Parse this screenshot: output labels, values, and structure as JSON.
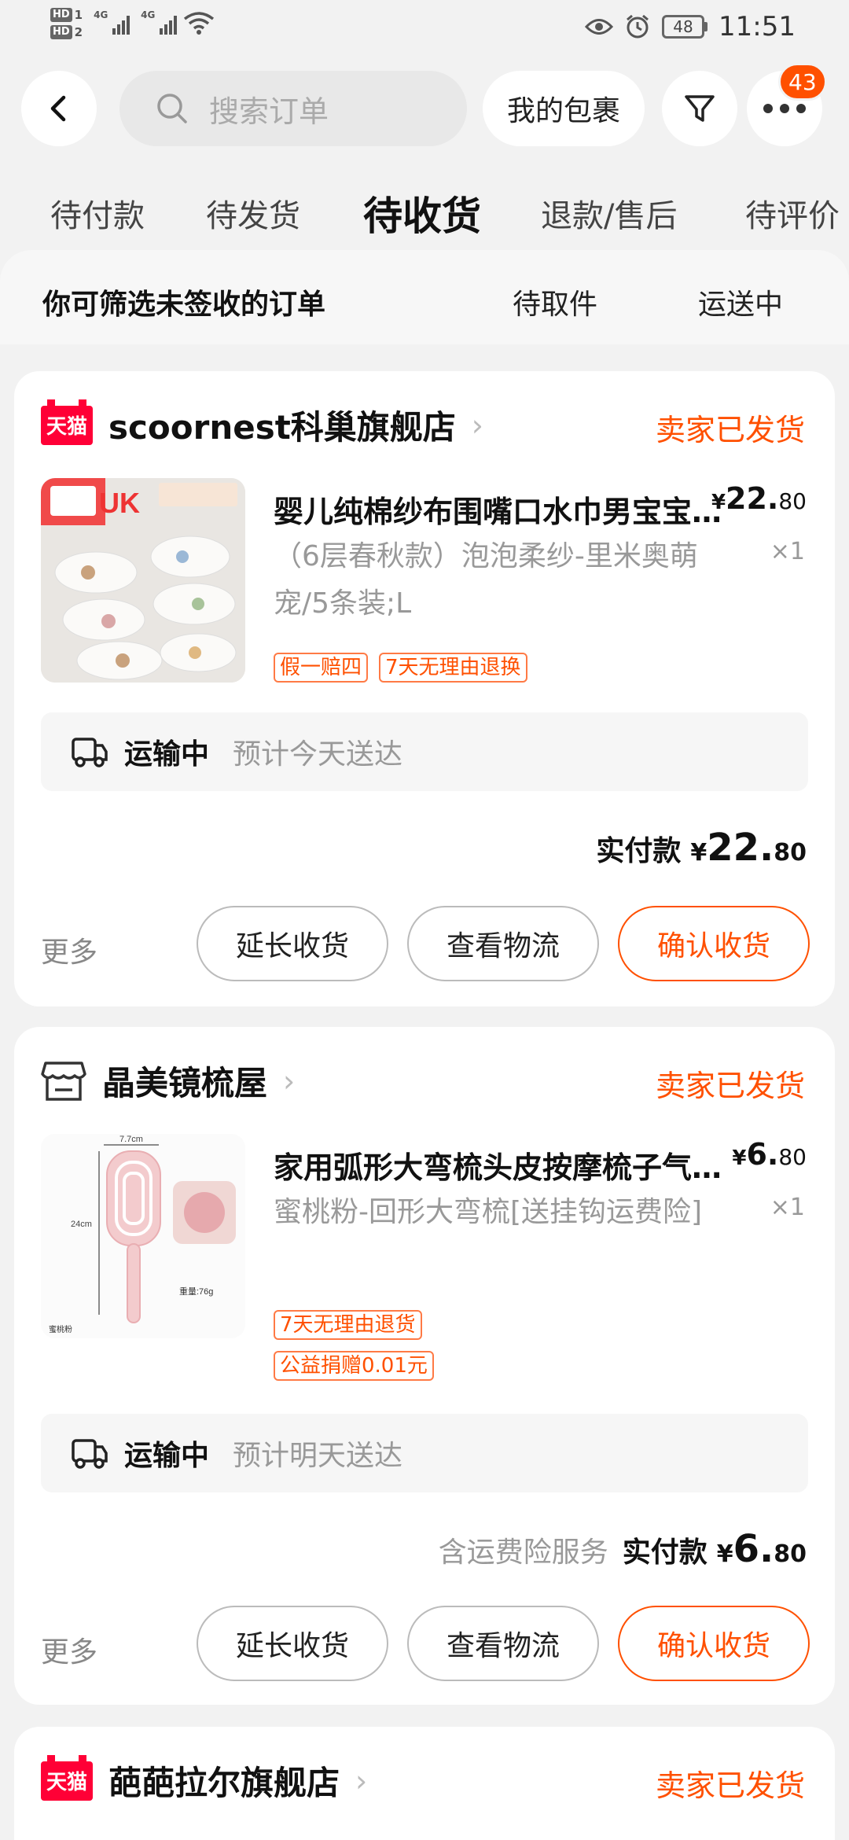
{
  "status_bar": {
    "hd1": "HD",
    "hd1_sub": "1",
    "hd2": "HD",
    "hd2_sub": "2",
    "net1": "4G",
    "net2": "4G",
    "battery": "48",
    "time": "11:51"
  },
  "header": {
    "search_placeholder": "搜索订单",
    "packages_label": "我的包裹",
    "badge_count": "43"
  },
  "tabs": [
    {
      "label": "待付款",
      "active": false
    },
    {
      "label": "待发货",
      "active": false
    },
    {
      "label": "待收货",
      "active": true
    },
    {
      "label": "退款/售后",
      "active": false
    },
    {
      "label": "待评价",
      "active": false
    }
  ],
  "filter": {
    "title": "你可筛选未签收的订单",
    "chip1": "待取件",
    "chip2": "运送中"
  },
  "orders": [
    {
      "shop_badge": "天猫",
      "shop_name": "scoornest科巢旗舰店",
      "chevron": "›",
      "status": "卖家已发货",
      "thumb_text": "UK",
      "title": "婴儿纯棉纱布围嘴口水巾男宝宝女宝宝",
      "spec": "（6层春秋款）泡泡柔纱-里米奥萌宠/5条装;L",
      "price_currency": "¥",
      "price_int": "22.",
      "price_dec": "80",
      "qty": "×1",
      "tags": [
        "假一赔四",
        "7天无理由退换"
      ],
      "logistics_status": "运输中",
      "logistics_eta": "预计今天送达",
      "paid_label": "实付款",
      "paid_currency": "¥",
      "paid_int": "22.",
      "paid_dec": "80",
      "more": "更多",
      "btn_extend": "延长收货",
      "btn_track": "查看物流",
      "btn_confirm": "确认收货"
    },
    {
      "shop_name": "晶美镜梳屋",
      "chevron": "›",
      "status": "卖家已发货",
      "thumb_dim_w": "7.7cm",
      "thumb_dim_h": "24cm",
      "thumb_weight": "重量:76g",
      "thumb_color": "蜜桃粉",
      "title": "家用弧形大弯梳头皮按摩梳子气囊梳",
      "spec": "蜜桃粉-回形大弯梳[送挂钩运费险]",
      "price_currency": "¥",
      "price_int": "6.",
      "price_dec": "80",
      "qty": "×1",
      "tags": [
        "7天无理由退货",
        "公益捐赠0.01元"
      ],
      "logistics_status": "运输中",
      "logistics_eta": "预计明天送达",
      "insurance": "含运费险服务",
      "paid_label": "实付款",
      "paid_currency": "¥",
      "paid_int": "6.",
      "paid_dec": "80",
      "more": "更多",
      "btn_extend": "延长收货",
      "btn_track": "查看物流",
      "btn_confirm": "确认收货"
    },
    {
      "shop_badge": "天猫",
      "shop_name": "葩葩拉尔旗舰店",
      "chevron": "›",
      "status": "卖家已发货"
    }
  ],
  "colors": {
    "accent": "#ff5000",
    "tmall_red": "#ff0036",
    "background": "#f2f2f2"
  }
}
